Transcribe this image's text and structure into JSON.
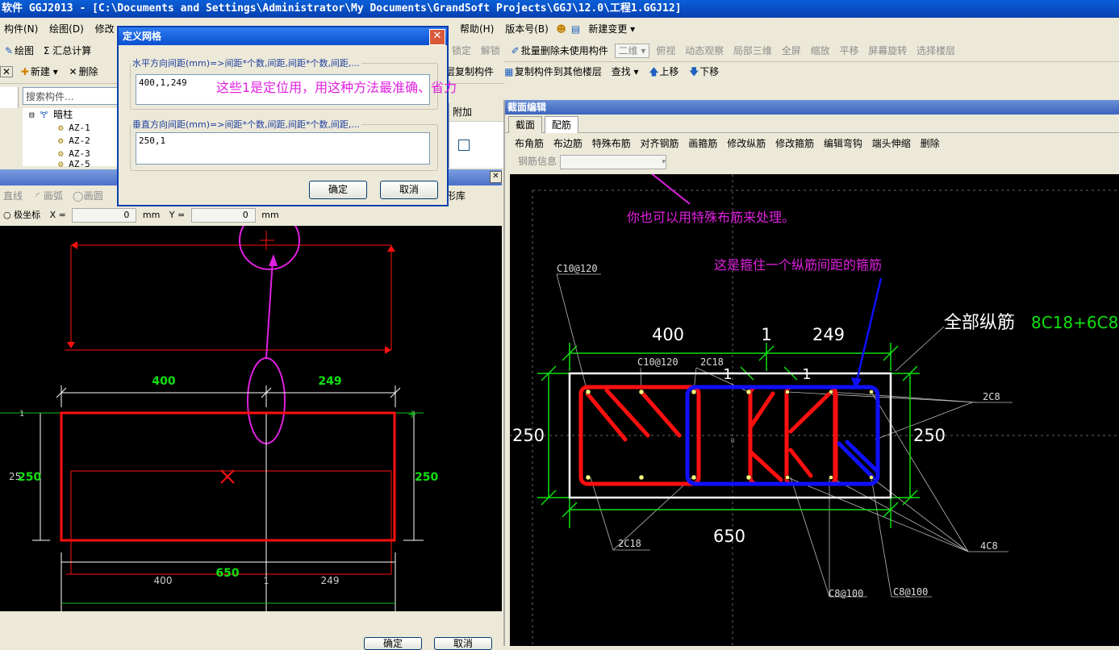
{
  "window_title": "软件 GGJ2013 - [C:\\Documents and Settings\\Administrator\\My Documents\\GrandSoft Projects\\GGJ\\12.0\\工程1.GGJ12]",
  "menu": {
    "items": [
      "构件(N)",
      "绘图(D)",
      "修改"
    ],
    "right_items": [
      "帮助(H)",
      "版本号(B)",
      "新建变更 ▾"
    ]
  },
  "toolbar1": {
    "left": [
      "绘图",
      "Σ 汇总计算"
    ],
    "right": [
      "锁定",
      "解锁",
      "批量删除未使用构件",
      "二维",
      "俯视",
      "动态观察",
      "局部三维",
      "全屏",
      "缩放",
      "平移",
      "屏幕旋转",
      "选择楼层"
    ]
  },
  "toolbar2": {
    "left": [
      "新建",
      "删除"
    ],
    "right": [
      "层复制构件",
      "复制构件到其他楼层",
      "查找",
      "上移",
      "下移"
    ]
  },
  "search": {
    "placeholder": "搜索构件..."
  },
  "tree": {
    "root": "暗柱",
    "items": [
      "AZ-1",
      "AZ-2",
      "AZ-3",
      "AZ-5"
    ]
  },
  "prop_header": "附加",
  "draw_toolbar": {
    "items": [
      "直线",
      "画弧",
      "画圆"
    ],
    "right": "形库"
  },
  "coord_bar": {
    "polar": "极坐标",
    "x_label": "X =",
    "x_value": "0",
    "y_label": "Y =",
    "y_value": "0",
    "unit": "mm"
  },
  "dialog": {
    "title": "定义网格",
    "horizontal_label": "水平方向间距(mm)=>间距*个数,间距,间距*个数,间距,...",
    "horizontal_value": "400,1,249",
    "vertical_label": "垂直方向间距(mm)=>间距*个数,间距,间距*个数,间距,...",
    "vertical_value": "250,1",
    "ok": "确定",
    "cancel": "取消"
  },
  "annotations": {
    "dialog_note": "这些1是定位用，用这种方法最准确、省力",
    "special_note": "你也可以用特殊布筋来处理。",
    "stirrup_note": "这是箍住一个纵筋间距的箍筋"
  },
  "left_canvas": {
    "dims_top": [
      "400",
      "249"
    ],
    "dims_side": [
      "250",
      "250"
    ],
    "side_small": "25",
    "label_1": "1",
    "bottom_main": "650",
    "bottom_sub": [
      "400",
      "1",
      "249"
    ]
  },
  "bottom_buttons": {
    "ok": "确定",
    "cancel": "取消"
  },
  "section_panel": {
    "title": "截面编辑",
    "tabs": [
      "截面",
      "配筋"
    ],
    "toolbar": [
      "布角筋",
      "布边筋",
      "特殊布筋",
      "对齐钢筋",
      "画箍筋",
      "修改纵筋",
      "修改箍筋",
      "编辑弯钩",
      "端头伸缩",
      "删除"
    ],
    "rebar_info_label": "钢筋信息"
  },
  "section_canvas": {
    "all_rebar_label": "全部纵筋",
    "all_rebar_value": "8C18+6C8",
    "dim_top": [
      "400",
      "1",
      "249"
    ],
    "dim_inner": [
      "1",
      "1"
    ],
    "dim_left": "250",
    "dim_right": "250",
    "dim_bottom": "650",
    "labels": [
      "C10@120",
      "C10@120",
      "2C18",
      "2C8",
      "2C18",
      "4C8",
      "C8@100",
      "C8@100"
    ],
    "origin": "0"
  },
  "colors": {
    "magenta": "#e020e0",
    "red": "#ff1010",
    "blue": "#1010ff",
    "green": "#10e010"
  }
}
